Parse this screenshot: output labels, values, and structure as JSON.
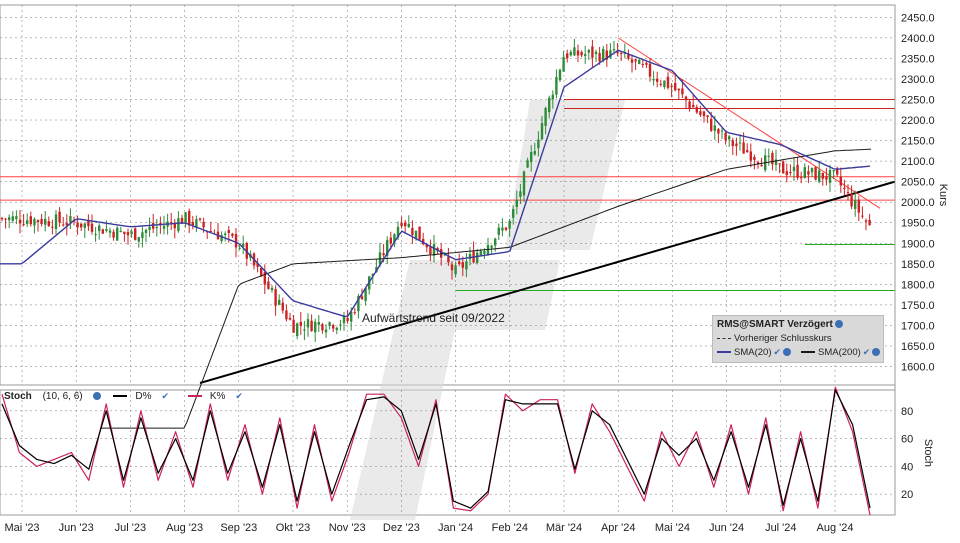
{
  "chart_data": [
    {
      "type": "candlestick",
      "title": "RMS@SMART Verzögert",
      "ylabel": "Kurs",
      "ylim": [
        1555,
        2480
      ],
      "y_ticks": [
        1600,
        1650,
        1700,
        1750,
        1800,
        1850,
        1900,
        1950,
        2000,
        2050,
        2100,
        2150,
        2200,
        2250,
        2300,
        2350,
        2400,
        2450
      ],
      "y_tick_labels": [
        "1600.0",
        "1650.0",
        "1700.0",
        "1750.0",
        "1800.0",
        "1850.0",
        "1900.0",
        "1950.0",
        "2000.0",
        "2050.0",
        "2100.0",
        "2150.0",
        "2200.0",
        "2250.0",
        "2300.0",
        "2350.0",
        "2400.0",
        "2450.0"
      ],
      "x_tick_labels": [
        "Mai '23",
        "Jun '23",
        "Jul '23",
        "Aug '23",
        "Sep '23",
        "Okt '23",
        "Nov '23",
        "Dez '23",
        "Jan '24",
        "Feb '24",
        "Mär '24",
        "Apr '24",
        "Mai '24",
        "Jun '24",
        "Jul '24",
        "Aug '24"
      ],
      "grid": true,
      "price_path": [
        [
          "Mai '23",
          1960
        ],
        [
          "Jun '23",
          1950
        ],
        [
          "Jul '23",
          1920
        ],
        [
          "Aug '23",
          1960
        ],
        [
          "Sep '23",
          1900
        ],
        [
          "Okt '23",
          1700
        ],
        [
          "Nov '23",
          1710
        ],
        [
          "Dez '23",
          1960
        ],
        [
          "Jan '24",
          1830
        ],
        [
          "Feb '24",
          1950
        ],
        [
          "Mär '24",
          2360
        ],
        [
          "Apr '24",
          2360
        ],
        [
          "Mai '24",
          2280
        ],
        [
          "Jun '24",
          2150
        ],
        [
          "Jul '24",
          2080
        ],
        [
          "Aug '24",
          2060
        ],
        [
          "Aug '24 end",
          1905
        ]
      ],
      "sma20_path": [
        [
          "Mai '23",
          1850
        ],
        [
          "Jun '23",
          1960
        ],
        [
          "Jul '23",
          1940
        ],
        [
          "Aug '23",
          1950
        ],
        [
          "Sep '23",
          1900
        ],
        [
          "Okt '23",
          1760
        ],
        [
          "Nov '23",
          1720
        ],
        [
          "Dez '23",
          1930
        ],
        [
          "Jan '24",
          1860
        ],
        [
          "Feb '24",
          1880
        ],
        [
          "Mär '24",
          2280
        ],
        [
          "Apr '24",
          2370
        ],
        [
          "Mai '24",
          2320
        ],
        [
          "Jun '24",
          2170
        ],
        [
          "Jul '24",
          2140
        ],
        [
          "Aug '24",
          2080
        ],
        [
          "Aug '24 end",
          2090
        ]
      ],
      "sma200_path": [
        [
          "Aug '23",
          1450
        ],
        [
          "Sep '23",
          1800
        ],
        [
          "Okt '23",
          1850
        ],
        [
          "Dez '23",
          1865
        ],
        [
          "Feb '24",
          1890
        ],
        [
          "Apr '24",
          1990
        ],
        [
          "Jun '24",
          2080
        ],
        [
          "Aug '24",
          2125
        ],
        [
          "Aug '24 end",
          2130
        ]
      ],
      "trendlines": [
        {
          "label": "Aufwärtstrend seit 09/2022",
          "from": [
            "Sep '23",
            1555
          ],
          "to": [
            "Aug '24 end",
            2050
          ],
          "color": "#000000"
        },
        {
          "from": [
            "Apr '24",
            2400
          ],
          "to": [
            "Aug '24 end",
            1985
          ],
          "color": "#ff4040"
        }
      ],
      "horizontal_lines": [
        {
          "y": 2250,
          "color": "#cc2222",
          "from": "Mär '24"
        },
        {
          "y": 2228,
          "color": "#cc2222",
          "from": "Mär '24"
        },
        {
          "y": 2062,
          "color": "#ff4040"
        },
        {
          "y": 2005,
          "color": "#ff4040"
        },
        {
          "y": 1897,
          "color": "#22aa22",
          "from": "Aug '24"
        },
        {
          "y": 1785,
          "color": "#22aa22",
          "from": "Jan '24"
        }
      ],
      "annotations": [
        "Aufwärtstrend seit 09/2022"
      ],
      "legend": {
        "title": "RMS@SMART Verzögert",
        "items": [
          "Vorheriger Schlusskurs",
          "SMA(20)",
          "SMA(200)"
        ],
        "placement": "bottom-right"
      }
    },
    {
      "type": "line",
      "title": "Stoch",
      "params": "(10, 6, 6)",
      "ylabel": "Stoch",
      "ylim": [
        5,
        95
      ],
      "y_ticks": [
        20,
        40,
        60,
        80
      ],
      "series": [
        {
          "name": "D%",
          "color": "#000000",
          "values": [
            85,
            55,
            45,
            42,
            48,
            38,
            80,
            30,
            75,
            35,
            60,
            30,
            80,
            35,
            65,
            25,
            70,
            15,
            65,
            20,
            55,
            88,
            90,
            80,
            45,
            85,
            15,
            10,
            22,
            88,
            85,
            85,
            85,
            38,
            80,
            70,
            45,
            20,
            60,
            48,
            60,
            30,
            65,
            25,
            70,
            12,
            60,
            15,
            95,
            70,
            10
          ]
        },
        {
          "name": "K%",
          "color": "#cc2255",
          "values": [
            92,
            50,
            40,
            45,
            50,
            30,
            85,
            25,
            80,
            30,
            65,
            25,
            85,
            30,
            70,
            20,
            75,
            10,
            70,
            15,
            50,
            92,
            92,
            75,
            40,
            88,
            10,
            8,
            20,
            92,
            80,
            88,
            88,
            35,
            85,
            65,
            40,
            15,
            65,
            40,
            65,
            25,
            70,
            20,
            75,
            8,
            65,
            10,
            97,
            65,
            5
          ]
        }
      ]
    }
  ],
  "stoch_panel": {
    "title": "Stoch",
    "params": "(10, 6, 6)",
    "d_label": "D%",
    "k_label": "K%"
  },
  "colors": {
    "up": "#2e8b3a",
    "down": "#cc2222",
    "sma20": "#3b3b9e",
    "sma200": "#1a1a1a"
  }
}
